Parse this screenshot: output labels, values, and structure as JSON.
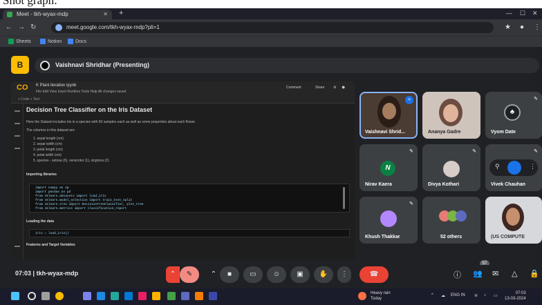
{
  "caption": "Shot graph:",
  "browser": {
    "tab_title": "Meet - tkh-wyax-mdp",
    "url": "meet.google.com/tkh-wyax-mdp?pli=1",
    "bookmarks": [
      "Sheets",
      "Notion",
      "Docs"
    ]
  },
  "meet": {
    "presenter_chip": "Vaishnavi Shridhar (Presenting)",
    "meeting_time": "07:03",
    "meeting_code": "tkh-wyax-mdp",
    "participant_count": "57"
  },
  "notebook": {
    "title": "K Plant iteration ipynb",
    "menu": "File  Edit  View  Insert  Runtime  Tools  Help  All changes saved",
    "share_label": "Share",
    "comment_label": "Comment",
    "heading": "Decision Tree Classifier on the Iris Dataset",
    "intro": "Here the Dataset includes iris in a species with 50 samples each as well as some properties about each flower.",
    "columns_label": "The columns in this dataset are:",
    "columns": [
      "1. sepal length (cm)",
      "2. sepal width (cm)",
      "3. petal length (cm)",
      "4. petal width (cm)",
      "5. species - setosa (0), versicolor (1), virginica (2)"
    ],
    "importing_label": "Importing libraries",
    "code1": [
      "import numpy as np",
      "import pandas as pd",
      "from sklearn.datasets import load_iris",
      "from sklearn.model_selection import train_test_split",
      "from sklearn.tree import DecisionTreeClassifier, plot_tree",
      "from sklearn.metrics import classification_report"
    ],
    "loading_label": "Loading the data",
    "code2": "iris = load_iris()",
    "features_label": "Features and Target Variables"
  },
  "participants": [
    {
      "name": "Vaishnavi Shrid...",
      "kind": "video",
      "selected": true
    },
    {
      "name": "Ananya Gadre",
      "kind": "video"
    },
    {
      "name": "Vyom Date",
      "kind": "avatar",
      "initial": "",
      "color": "#202124"
    },
    {
      "name": "Nirav Kaera",
      "kind": "avatar",
      "initial": "N",
      "color": "#0b8043"
    },
    {
      "name": "Divya Kothari",
      "kind": "avatar",
      "initial": "",
      "color": "#d7ccc8"
    },
    {
      "name": "Vivek Chauhan",
      "kind": "avatar",
      "initial": "",
      "color": "#1a73e8"
    },
    {
      "name": "Khush Thakkar",
      "kind": "avatar",
      "initial": "",
      "color": "#b388ff"
    },
    {
      "name": "52 others",
      "kind": "group"
    },
    {
      "name": "(US COMPUTE",
      "kind": "video"
    }
  ],
  "taskbar": {
    "weather_line1": "Heavy rain",
    "weather_line2": "Today",
    "lang": "ENG IN",
    "time": "07:03",
    "date": "13-03-2024"
  }
}
